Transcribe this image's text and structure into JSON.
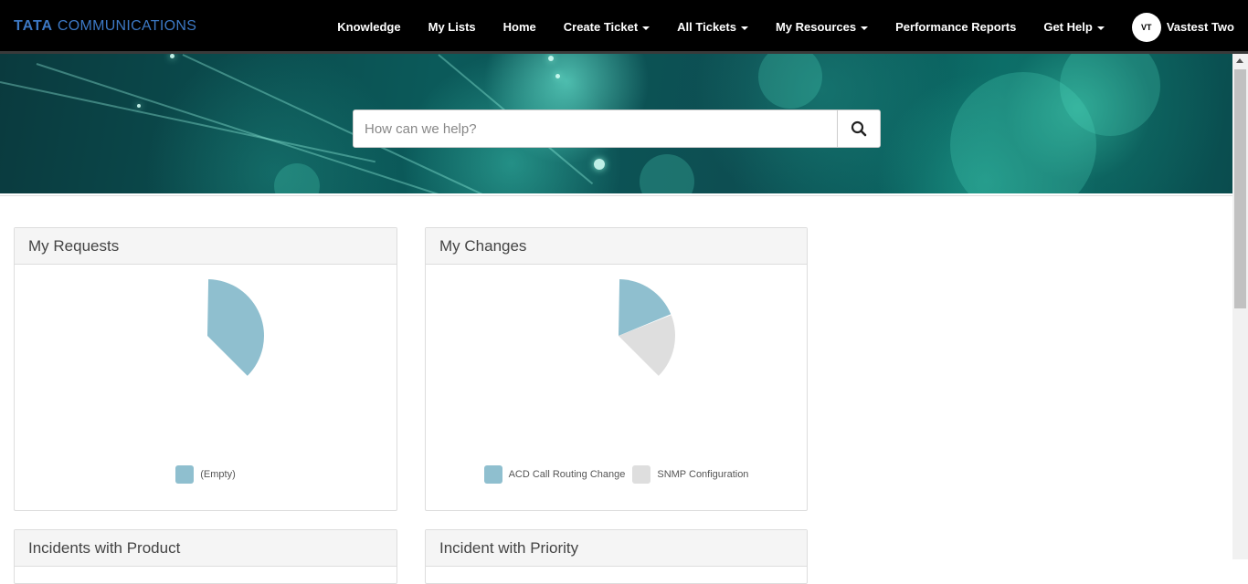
{
  "brand": {
    "bold": "TATA",
    "rest": "COMMUNICATIONS"
  },
  "nav": {
    "knowledge": "Knowledge",
    "my_lists": "My Lists",
    "home": "Home",
    "create_ticket": "Create Ticket",
    "all_tickets": "All Tickets",
    "my_resources": "My Resources",
    "performance_reports": "Performance Reports",
    "get_help": "Get Help"
  },
  "user": {
    "initials": "VT",
    "name": "Vastest Two"
  },
  "search": {
    "placeholder": "How can we help?"
  },
  "panels": {
    "my_requests": {
      "title": "My Requests"
    },
    "my_changes": {
      "title": "My Changes"
    },
    "incidents_with_product": {
      "title": "Incidents with Product"
    },
    "incident_with_priority": {
      "title": "Incident with Priority"
    }
  },
  "colors": {
    "series_blue": "#8fbfcf",
    "series_gray": "#dedede"
  },
  "chart_data": [
    {
      "type": "pie",
      "title": "My Requests",
      "series": [
        {
          "name": "(Empty)",
          "values": [
            1
          ]
        }
      ],
      "legend": [
        "(Empty)"
      ]
    },
    {
      "type": "pie",
      "title": "My Changes",
      "series": [
        {
          "name": "ACD Call Routing Change",
          "values": [
            1
          ]
        },
        {
          "name": "SNMP Configuration",
          "values": [
            1
          ]
        }
      ],
      "legend": [
        "ACD Call Routing Change",
        "SNMP Configuration"
      ]
    }
  ]
}
